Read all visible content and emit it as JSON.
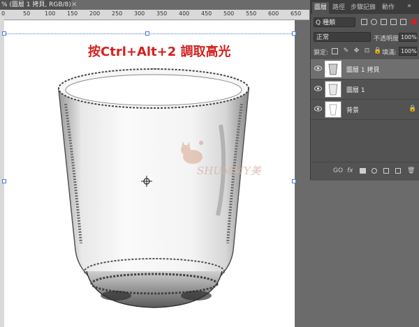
{
  "document": {
    "tab_title": "% (圖層 1 拷貝, RGB/8) *",
    "close_glyph": "×"
  },
  "ruler": {
    "labels": [
      "0",
      "50",
      "100",
      "150",
      "200",
      "250",
      "300",
      "350",
      "400",
      "450",
      "500",
      "550",
      "600",
      "650"
    ]
  },
  "canvas": {
    "caption": "按Ctrl+Alt+2 調取高光",
    "watermark_text": "SHUMMY美"
  },
  "panel": {
    "tabs": [
      "圖層",
      "路徑",
      "步驟記錄",
      "動作"
    ],
    "more_glyph": "»",
    "filter": {
      "kind_label": "Q 種類"
    },
    "blend": {
      "mode": "正常",
      "opacity_label": "不透明度:",
      "opacity_value": "100%"
    },
    "lock": {
      "label": "鎖定:",
      "fill_label": "填滿:",
      "fill_value": "100%"
    },
    "layers": [
      {
        "name": "圖層 1 拷貝",
        "selected": true
      },
      {
        "name": "圖層 1",
        "selected": false
      },
      {
        "name": "背景",
        "selected": false,
        "locked": true
      }
    ],
    "footer": {
      "link": "GO",
      "fx": "fx"
    }
  },
  "colors": {
    "caption": "#d42020",
    "panel_bg": "#535353",
    "workspace": "#6b6b6b",
    "selection": "#4a7bd0"
  }
}
